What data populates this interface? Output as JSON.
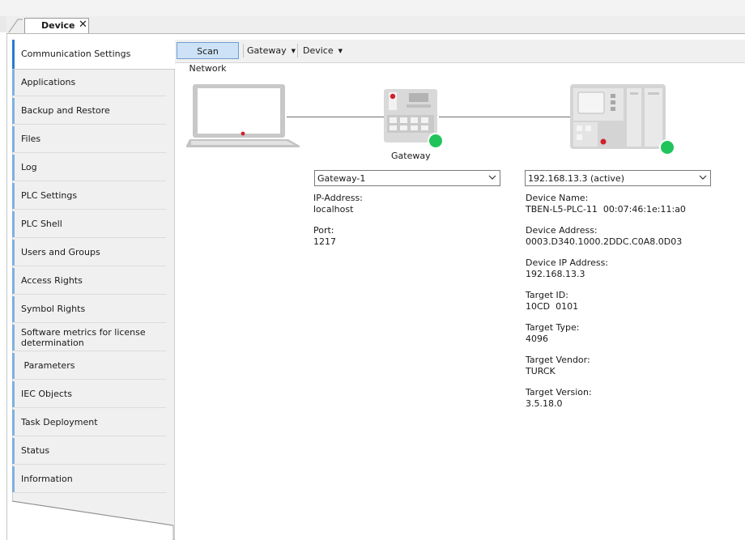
{
  "tab": {
    "title": "Device"
  },
  "toolbar": {
    "scan_network": "Scan Network",
    "gateway": "Gateway",
    "device": "Device"
  },
  "sidebar": {
    "items": [
      {
        "label": "Communication Settings",
        "active": true
      },
      {
        "label": "Applications"
      },
      {
        "label": "Backup and Restore"
      },
      {
        "label": "Files"
      },
      {
        "label": "Log"
      },
      {
        "label": "PLC Settings"
      },
      {
        "label": "PLC Shell"
      },
      {
        "label": "Users and Groups"
      },
      {
        "label": "Access Rights"
      },
      {
        "label": "Symbol Rights"
      },
      {
        "label": "Software metrics for license determination"
      },
      {
        "label": " Parameters"
      },
      {
        "label": "IEC Objects"
      },
      {
        "label": "Task Deployment"
      },
      {
        "label": "Status"
      },
      {
        "label": "Information"
      }
    ]
  },
  "gateway": {
    "caption": "Gateway",
    "selected": "Gateway-1",
    "ip_label": "IP-Address:",
    "ip_value": "localhost",
    "port_label": "Port:",
    "port_value": "1217",
    "status_color": "#21c45a"
  },
  "device": {
    "selected": "192.168.13.3 (active)",
    "status_color": "#21c45a",
    "fields": [
      {
        "label": "Device Name:",
        "value": "TBEN-L5-PLC-11  00:07:46:1e:11:a0"
      },
      {
        "label": "Device Address:",
        "value": "0003.D340.1000.2DDC.C0A8.0D03"
      },
      {
        "label": "Device IP Address:",
        "value": "192.168.13.3"
      },
      {
        "label": "Target ID:",
        "value": "10CD  0101"
      },
      {
        "label": "Target Type:",
        "value": "4096"
      },
      {
        "label": "Target Vendor:",
        "value": "TURCK"
      },
      {
        "label": "Target Version:",
        "value": "3.5.18.0"
      }
    ]
  },
  "icons": {
    "laptop": "laptop-icon",
    "gateway": "gateway-device-icon",
    "plc": "plc-device-icon",
    "close": "close-icon",
    "chevron": "chevron-down-icon"
  }
}
